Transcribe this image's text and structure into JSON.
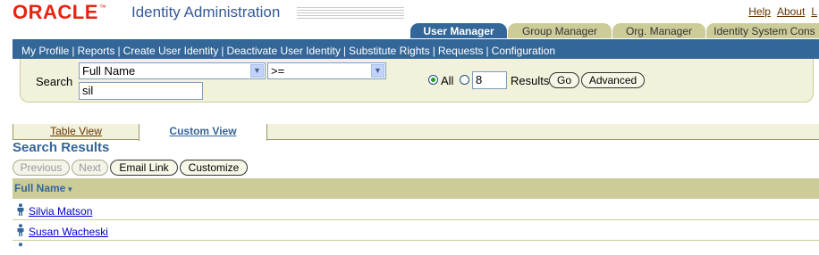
{
  "header": {
    "logo": "ORACLE",
    "app_title": "Identity Administration",
    "global_links": [
      "Help",
      "About",
      "L"
    ]
  },
  "tabs": [
    {
      "label": "User Manager",
      "active": true
    },
    {
      "label": "Group Manager",
      "active": false
    },
    {
      "label": "Org. Manager",
      "active": false
    },
    {
      "label": "Identity System Cons",
      "active": false
    }
  ],
  "nav": {
    "items": [
      "My Profile",
      "Reports",
      "Create User Identity",
      "Deactivate User Identity",
      "Substitute Rights",
      "Requests",
      "Configuration"
    ],
    "separator": "|"
  },
  "search": {
    "label": "Search",
    "attribute_select": "Full Name",
    "operator_select": ">=",
    "query_value": "sil",
    "radio_all_label": "All",
    "radio_all_selected": true,
    "results_count": "8",
    "results_label": "Results",
    "go_label": "Go",
    "advanced_label": "Advanced"
  },
  "view_tabs": {
    "table_view": "Table View",
    "custom_view": "Custom View"
  },
  "results": {
    "title": "Search Results",
    "previous_label": "Previous",
    "next_label": "Next",
    "email_link_label": "Email Link",
    "customize_label": "Customize",
    "column_header": "Full Name",
    "rows": [
      "Silvia Matson",
      "Susan Wacheski"
    ]
  },
  "colors": {
    "brand_red": "#e8230e",
    "nav_blue": "#336699",
    "tan": "#cccc99"
  }
}
